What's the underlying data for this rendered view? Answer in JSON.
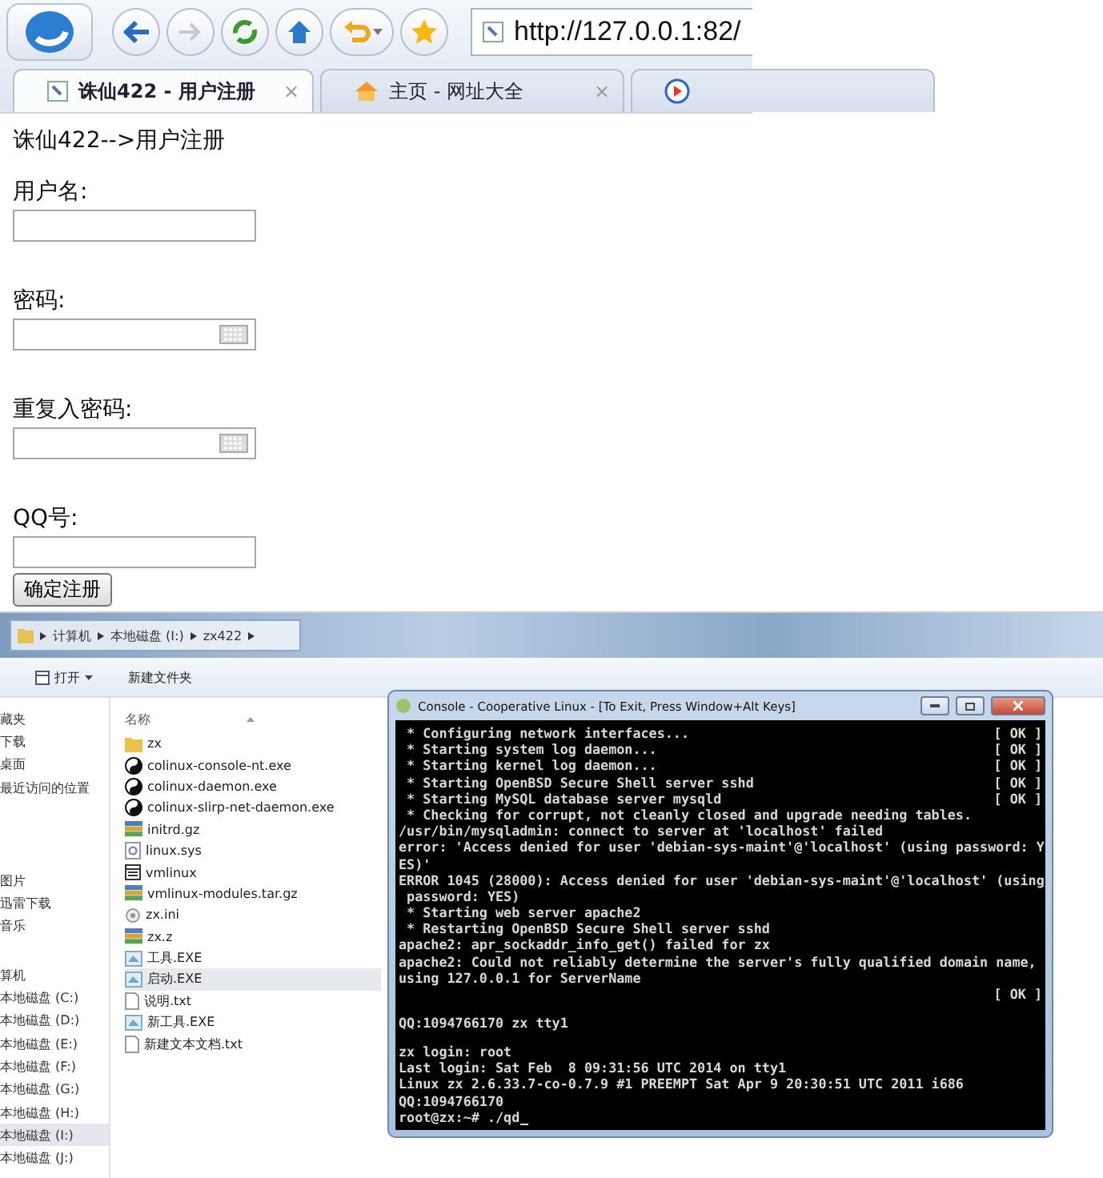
{
  "browser": {
    "url": "http://127.0.0.1:82/",
    "tabs": [
      {
        "title": "诛仙422 - 用户注册",
        "kind": "page",
        "close": "×",
        "selected": true
      },
      {
        "title": "主页 - 网址大全",
        "kind": "home",
        "close": "×",
        "selected": false
      },
      {
        "kind": "media",
        "selected": false
      }
    ]
  },
  "form": {
    "heading": "诛仙422-->用户注册",
    "fields": [
      {
        "label": "用户名:",
        "kind": "text"
      },
      {
        "label": "密码:",
        "kind": "password"
      },
      {
        "label": "重复入密码:",
        "kind": "password"
      },
      {
        "label": "QQ号:",
        "kind": "text"
      }
    ],
    "submit": "确定注册"
  },
  "explorer": {
    "breadcrumb": [
      "计算机",
      "本地磁盘 (I:)",
      "zx422"
    ],
    "toolbar": [
      {
        "label": "打开",
        "kind": "menu"
      },
      {
        "label": "新建文件夹",
        "kind": "plain"
      }
    ],
    "sidebar": [
      {
        "items": [
          {
            "label": "藏夹",
            "selected": false
          },
          {
            "label": "下载",
            "selected": false
          },
          {
            "label": "桌面",
            "selected": false
          },
          {
            "label": "最近访问的位置",
            "selected": false
          }
        ]
      },
      {
        "items": [
          {
            "label": "图片",
            "selected": false
          },
          {
            "label": "迅雷下载",
            "selected": false
          },
          {
            "label": "音乐",
            "selected": false
          }
        ]
      },
      {
        "items": [
          {
            "label": "算机",
            "selected": false
          },
          {
            "label": "本地磁盘 (C:)",
            "selected": false
          },
          {
            "label": "本地磁盘 (D:)",
            "selected": false
          },
          {
            "label": "本地磁盘 (E:)",
            "selected": false
          },
          {
            "label": "本地磁盘 (F:)",
            "selected": false
          },
          {
            "label": "本地磁盘 (G:)",
            "selected": false
          },
          {
            "label": "本地磁盘 (H:)",
            "selected": false
          },
          {
            "label": "本地磁盘 (I:)",
            "selected": true
          },
          {
            "label": "本地磁盘 (J:)",
            "selected": false
          }
        ]
      }
    ],
    "column": "名称",
    "files": [
      {
        "name": "zx",
        "kind": "folder",
        "selected": false
      },
      {
        "name": "colinux-console-nt.exe",
        "kind": "colinux",
        "selected": false
      },
      {
        "name": "colinux-daemon.exe",
        "kind": "colinux",
        "selected": false
      },
      {
        "name": "colinux-slirp-net-daemon.exe",
        "kind": "colinux",
        "selected": false
      },
      {
        "name": "initrd.gz",
        "kind": "archive",
        "selected": false
      },
      {
        "name": "linux.sys",
        "kind": "system",
        "selected": false
      },
      {
        "name": "vmlinux",
        "kind": "binary",
        "selected": false
      },
      {
        "name": "vmlinux-modules.tar.gz",
        "kind": "archive",
        "selected": false
      },
      {
        "name": "zx.ini",
        "kind": "config",
        "selected": false
      },
      {
        "name": "zx.z",
        "kind": "archive",
        "selected": false
      },
      {
        "name": "工具.EXE",
        "kind": "program",
        "selected": false
      },
      {
        "name": "启动.EXE",
        "kind": "program",
        "selected": true
      },
      {
        "name": "说明.txt",
        "kind": "text",
        "selected": false
      },
      {
        "name": "新工具.EXE",
        "kind": "program",
        "selected": false
      },
      {
        "name": "新建文本文档.txt",
        "kind": "text",
        "selected": false
      }
    ]
  },
  "console": {
    "title": "Console - Cooperative Linux - [To Exit, Press Window+Alt Keys]",
    "lines": [
      {
        "kind": "status",
        "text": " * Configuring network interfaces...",
        "status": "[ OK ]"
      },
      {
        "kind": "status",
        "text": " * Starting system log daemon...",
        "status": "[ OK ]"
      },
      {
        "kind": "status",
        "text": " * Starting kernel log daemon...",
        "status": "[ OK ]"
      },
      {
        "kind": "status",
        "text": " * Starting OpenBSD Secure Shell server sshd",
        "status": "[ OK ]"
      },
      {
        "kind": "status",
        "text": " * Starting MySQL database server mysqld",
        "status": "[ OK ]"
      },
      {
        "kind": "text",
        "text": " * Checking for corrupt, not cleanly closed and upgrade needing tables."
      },
      {
        "kind": "text",
        "text": "/usr/bin/mysqladmin: connect to server at 'localhost' failed"
      },
      {
        "kind": "text",
        "text": "error: 'Access denied for user 'debian-sys-maint'@'localhost' (using password: Y"
      },
      {
        "kind": "text",
        "text": "ES)'"
      },
      {
        "kind": "text",
        "text": "ERROR 1045 (28000): Access denied for user 'debian-sys-maint'@'localhost' (using"
      },
      {
        "kind": "text",
        "text": " password: YES)"
      },
      {
        "kind": "text",
        "text": " * Starting web server apache2"
      },
      {
        "kind": "text",
        "text": " * Restarting OpenBSD Secure Shell server sshd"
      },
      {
        "kind": "text",
        "text": "apache2: apr_sockaddr_info_get() failed for zx"
      },
      {
        "kind": "text",
        "text": "apache2: Could not reliably determine the server's fully qualified domain name,"
      },
      {
        "kind": "text",
        "text": "using 127.0.0.1 for ServerName"
      },
      {
        "kind": "status",
        "status": "[ OK ]"
      },
      {
        "kind": "blank"
      },
      {
        "kind": "text",
        "text": "QQ:1094766170 zx tty1"
      },
      {
        "kind": "blank"
      },
      {
        "kind": "text",
        "text": "zx login: root"
      },
      {
        "kind": "text",
        "text": "Last login: Sat Feb  8 09:31:56 UTC 2014 on tty1"
      },
      {
        "kind": "text",
        "text": "Linux zx 2.6.33.7-co-0.7.9 #1 PREEMPT Sat Apr 9 20:30:51 UTC 2011 i686"
      },
      {
        "kind": "text",
        "text": "QQ:1094766170"
      },
      {
        "kind": "prompt",
        "text": "root@zx:~# ./qd"
      }
    ]
  }
}
